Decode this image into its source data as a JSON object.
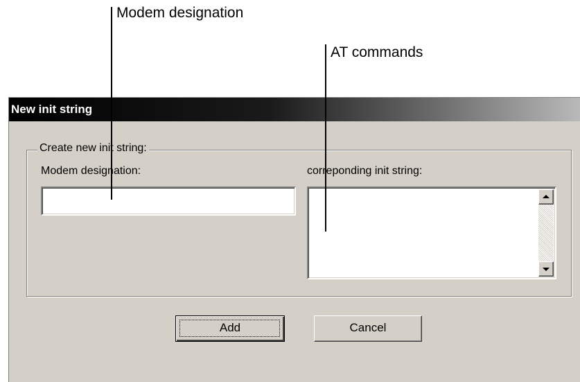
{
  "callouts": {
    "modem_designation": "Modem designation",
    "at_commands": "AT commands"
  },
  "dialog": {
    "title": "New init string",
    "group_label": "Create new init string:",
    "modem_label": "Modem designation:",
    "modem_value": "",
    "init_label": "correponding init string:",
    "init_value": "",
    "add_label": "Add",
    "cancel_label": "Cancel"
  },
  "colors": {
    "dialog_bg": "#d4d0c8",
    "titlebar_start": "#000000",
    "titlebar_end": "#bdbdbd"
  }
}
